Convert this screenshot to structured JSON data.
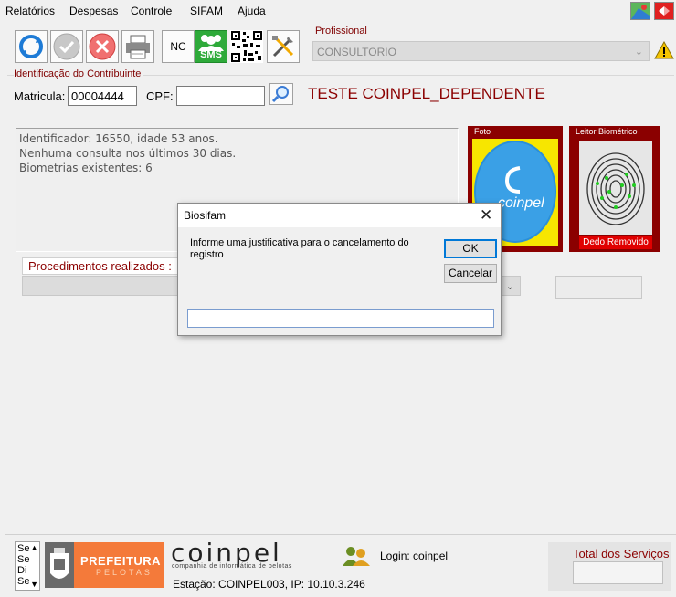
{
  "menu": {
    "items": [
      "Relatórios",
      "Despesas",
      "Controle",
      "SIFAM",
      "Ajuda"
    ]
  },
  "top_icons": [
    "map-icon",
    "exit-icon"
  ],
  "toolbar": {
    "nc_label": "NC",
    "sms_label": "SMS"
  },
  "profissional": {
    "label": "Profissional",
    "value": "CONSULTORIO"
  },
  "contribuinte": {
    "group_label": "Identificação do Contribuinte",
    "matricula_label": "Matricula:",
    "matricula_value": "00004444",
    "cpf_label": "CPF:",
    "cpf_value": "",
    "name": "TESTE COINPEL_DEPENDENTE"
  },
  "info": {
    "lines": [
      "Identificador: 16550, idade 53 anos.",
      "Nenhuma consulta nos últimos 30 dias.",
      "Biometrias existentes: 6"
    ]
  },
  "photo": {
    "label": "Foto",
    "logo_text": "coinpel"
  },
  "biometric": {
    "label": "Leitor Biométrico",
    "status": "Dedo Removido"
  },
  "procedures": {
    "label": "Procedimentos realizados :"
  },
  "dialog": {
    "title": "Biosifam",
    "message": "Informe uma justificativa para o cancelamento do registro",
    "ok_label": "OK",
    "cancel_label": "Cancelar",
    "input_value": ""
  },
  "footer": {
    "list_items": [
      "Se",
      "Se",
      "Di",
      "Se"
    ],
    "prefeitura_line1": "PREFEITURA",
    "prefeitura_line2": "PELOTAS",
    "coinpel_logo": "coinpel",
    "coinpel_tagline": "companhia de informática de pelotas",
    "station": "Estação: COINPEL003, IP: 10.10.3.246",
    "login": "Login: coinpel",
    "total_label": "Total dos Serviços",
    "total_value": ""
  },
  "colors": {
    "accent_dark_red": "#8b0000",
    "dialog_ok_border": "#0078d7",
    "prefeitura_orange": "#f47a3a"
  }
}
